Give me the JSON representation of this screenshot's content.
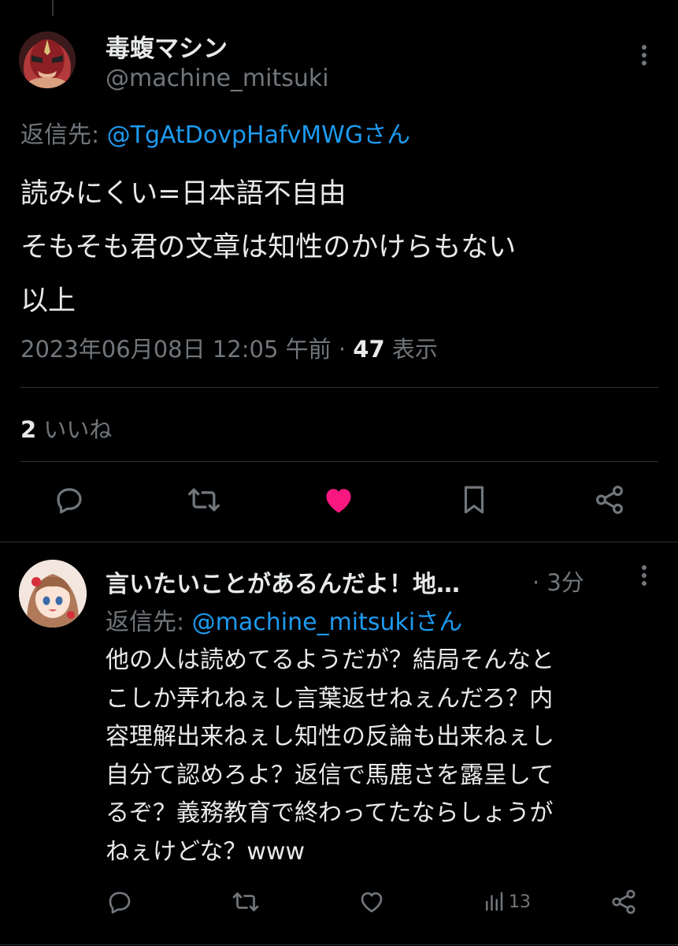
{
  "main_tweet": {
    "display_name": "毒蝮マシン",
    "handle": "@machine_mitsuki",
    "reply_prefix": "返信先: ",
    "reply_mention": "@TgAtDovpHafvMWGさん",
    "body_lines": [
      "読みにくい=日本語不自由",
      "そもそも君の文章は知性のかけらもない",
      "以上"
    ],
    "timestamp": "2023年06月08日 12:05 午前 · ",
    "views_count": "47",
    "views_label": " 表示",
    "likes_count": "2",
    "likes_label": " いいね",
    "icons": [
      "reply-icon",
      "retweet-icon",
      "like-icon-filled",
      "bookmark-icon",
      "share-icon",
      "more-icon"
    ],
    "like_color": "#f91880"
  },
  "reply_tweet": {
    "display_name": "言いたいことがあるんだよ！地…",
    "time": " · 3分",
    "reply_prefix": "返信先: ",
    "reply_mention": "@machine_mitsukiさん",
    "body_lines": [
      "他の人は読めてるようだが？結局そんなと",
      "こしか弄れねぇし言葉返せねぇんだろ？内",
      "容理解出来ねぇし知性の反論も出来ねぇし",
      "自分て認めろよ？返信で馬鹿さを露呈して",
      "るぞ？義務教育で終わってたならしょうが",
      "ねぇけどな？www"
    ],
    "views": "13",
    "icons": [
      "reply-icon",
      "retweet-icon",
      "like-icon",
      "views-icon",
      "share-icon",
      "more-icon"
    ]
  },
  "colors": {
    "background": "#000000",
    "text_primary": "#e7e9ea",
    "text_secondary": "#71767b",
    "link": "#1d9bf0",
    "divider": "#2f3336"
  }
}
